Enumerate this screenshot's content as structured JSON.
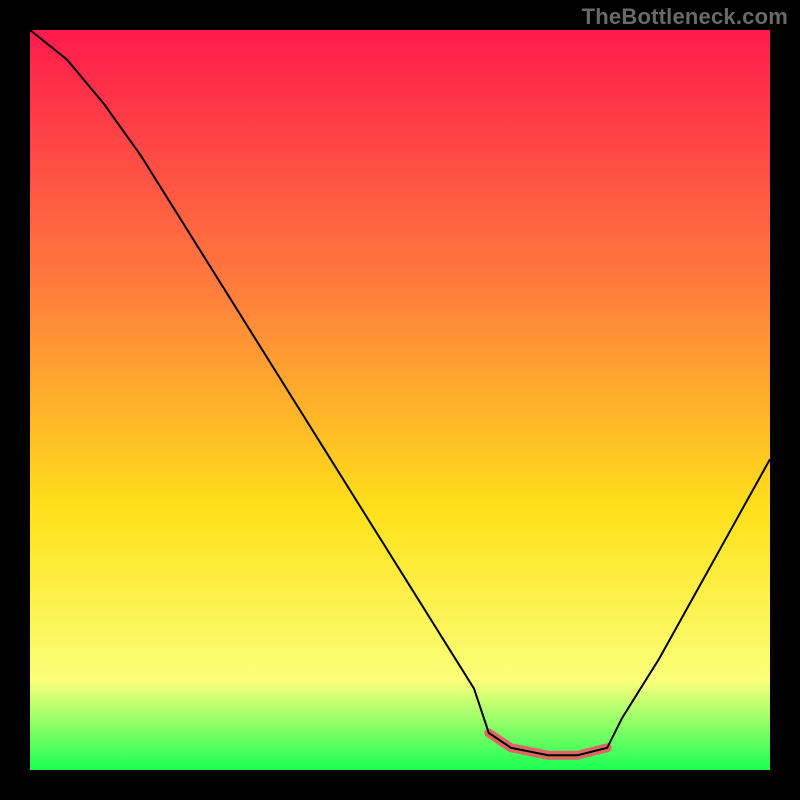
{
  "watermark": "TheBottleneck.com",
  "chart_data": {
    "type": "line",
    "title": "",
    "xlabel": "",
    "ylabel": "",
    "xlim": [
      0,
      100
    ],
    "ylim": [
      0,
      100
    ],
    "grid": false,
    "legend": "none",
    "background_gradient": {
      "top": "#ff1a4c",
      "mid_upper": "#ff7d3d",
      "mid": "#ffe11a",
      "mid_lower": "#faff7a",
      "bottom": "#1aff55"
    },
    "series": [
      {
        "name": "bottleneck-curve",
        "x": [
          0,
          5,
          10,
          15,
          20,
          25,
          30,
          35,
          40,
          45,
          50,
          55,
          60,
          62,
          65,
          70,
          74,
          78,
          80,
          85,
          90,
          95,
          100
        ],
        "y": [
          100,
          96,
          90,
          83,
          75,
          67,
          59,
          51,
          43,
          35,
          27,
          19,
          11,
          5,
          3,
          2,
          2,
          3,
          7,
          15,
          24,
          33,
          42
        ],
        "stroke": "#000000",
        "stroke_width": 2
      }
    ],
    "highlight_segment": {
      "name": "optimal-range",
      "x": [
        62,
        65,
        70,
        74,
        78
      ],
      "y": [
        5,
        3,
        2,
        2,
        3
      ],
      "stroke": "#e06666",
      "stroke_width": 9
    }
  }
}
